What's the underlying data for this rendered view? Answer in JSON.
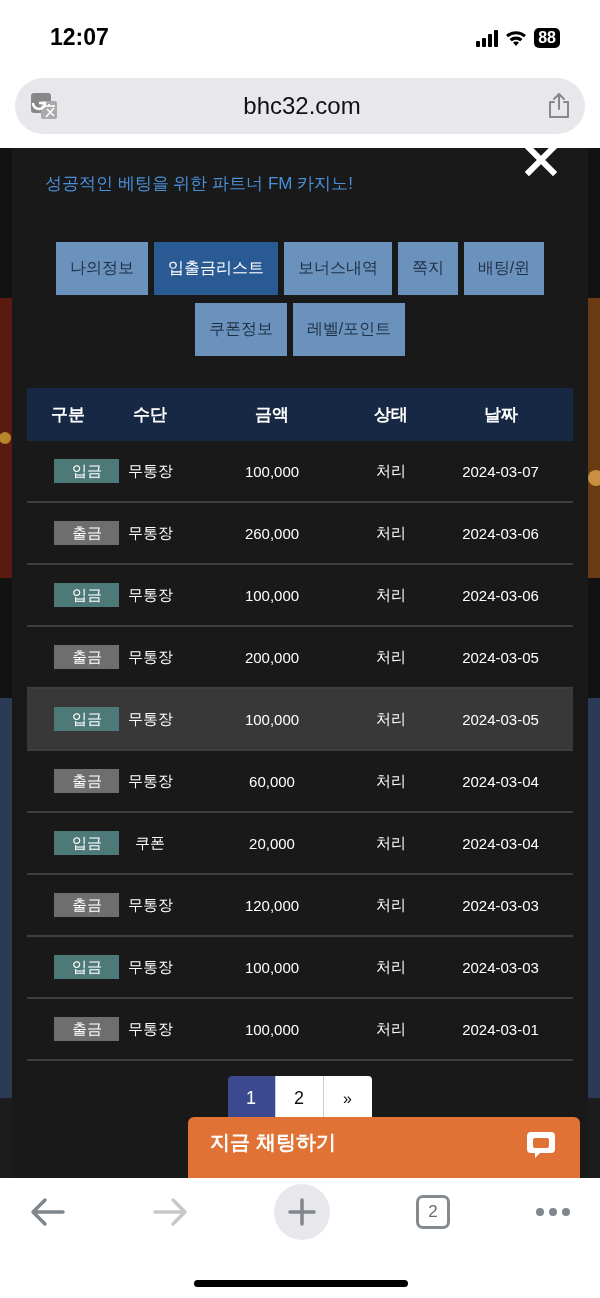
{
  "status_bar": {
    "time": "12:07",
    "battery": "88"
  },
  "address_bar": {
    "url": "bhc32.com"
  },
  "modal": {
    "subtitle": "성공적인 베팅을 위한 파트너 FM 카지노!",
    "tabs": [
      {
        "label": "나의정보",
        "selected": false
      },
      {
        "label": "입출금리스트",
        "selected": true
      },
      {
        "label": "보너스내역",
        "selected": false
      },
      {
        "label": "쪽지",
        "selected": false
      },
      {
        "label": "배팅/윈",
        "selected": false
      },
      {
        "label": "쿠폰정보",
        "selected": false
      },
      {
        "label": "레벨/포인트",
        "selected": false
      }
    ],
    "table": {
      "columns": [
        "구분",
        "수단",
        "금액",
        "상태",
        "날짜"
      ],
      "rows": [
        {
          "kind": "deposit",
          "type": "입금",
          "method": "무통장",
          "amount": "100,000",
          "status": "처리",
          "date": "2024-03-07",
          "hovered": false
        },
        {
          "kind": "withdraw",
          "type": "출금",
          "method": "무통장",
          "amount": "260,000",
          "status": "처리",
          "date": "2024-03-06",
          "hovered": false
        },
        {
          "kind": "deposit",
          "type": "입금",
          "method": "무통장",
          "amount": "100,000",
          "status": "처리",
          "date": "2024-03-06",
          "hovered": false
        },
        {
          "kind": "withdraw",
          "type": "출금",
          "method": "무통장",
          "amount": "200,000",
          "status": "처리",
          "date": "2024-03-05",
          "hovered": false
        },
        {
          "kind": "deposit",
          "type": "입금",
          "method": "무통장",
          "amount": "100,000",
          "status": "처리",
          "date": "2024-03-05",
          "hovered": true
        },
        {
          "kind": "withdraw",
          "type": "출금",
          "method": "무통장",
          "amount": "60,000",
          "status": "처리",
          "date": "2024-03-04",
          "hovered": false
        },
        {
          "kind": "deposit",
          "type": "입금",
          "method": "쿠폰",
          "amount": "20,000",
          "status": "처리",
          "date": "2024-03-04",
          "hovered": false
        },
        {
          "kind": "withdraw",
          "type": "출금",
          "method": "무통장",
          "amount": "120,000",
          "status": "처리",
          "date": "2024-03-03",
          "hovered": false
        },
        {
          "kind": "deposit",
          "type": "입금",
          "method": "무통장",
          "amount": "100,000",
          "status": "처리",
          "date": "2024-03-03",
          "hovered": false
        },
        {
          "kind": "withdraw",
          "type": "출금",
          "method": "무통장",
          "amount": "100,000",
          "status": "처리",
          "date": "2024-03-01",
          "hovered": false
        }
      ]
    },
    "pagination": [
      {
        "label": "1",
        "selected": true
      },
      {
        "label": "2",
        "selected": false
      },
      {
        "label": "»",
        "selected": false
      }
    ]
  },
  "chat_button": {
    "label": "지금 채팅하기"
  },
  "toolbar": {
    "tab_count": "2"
  }
}
